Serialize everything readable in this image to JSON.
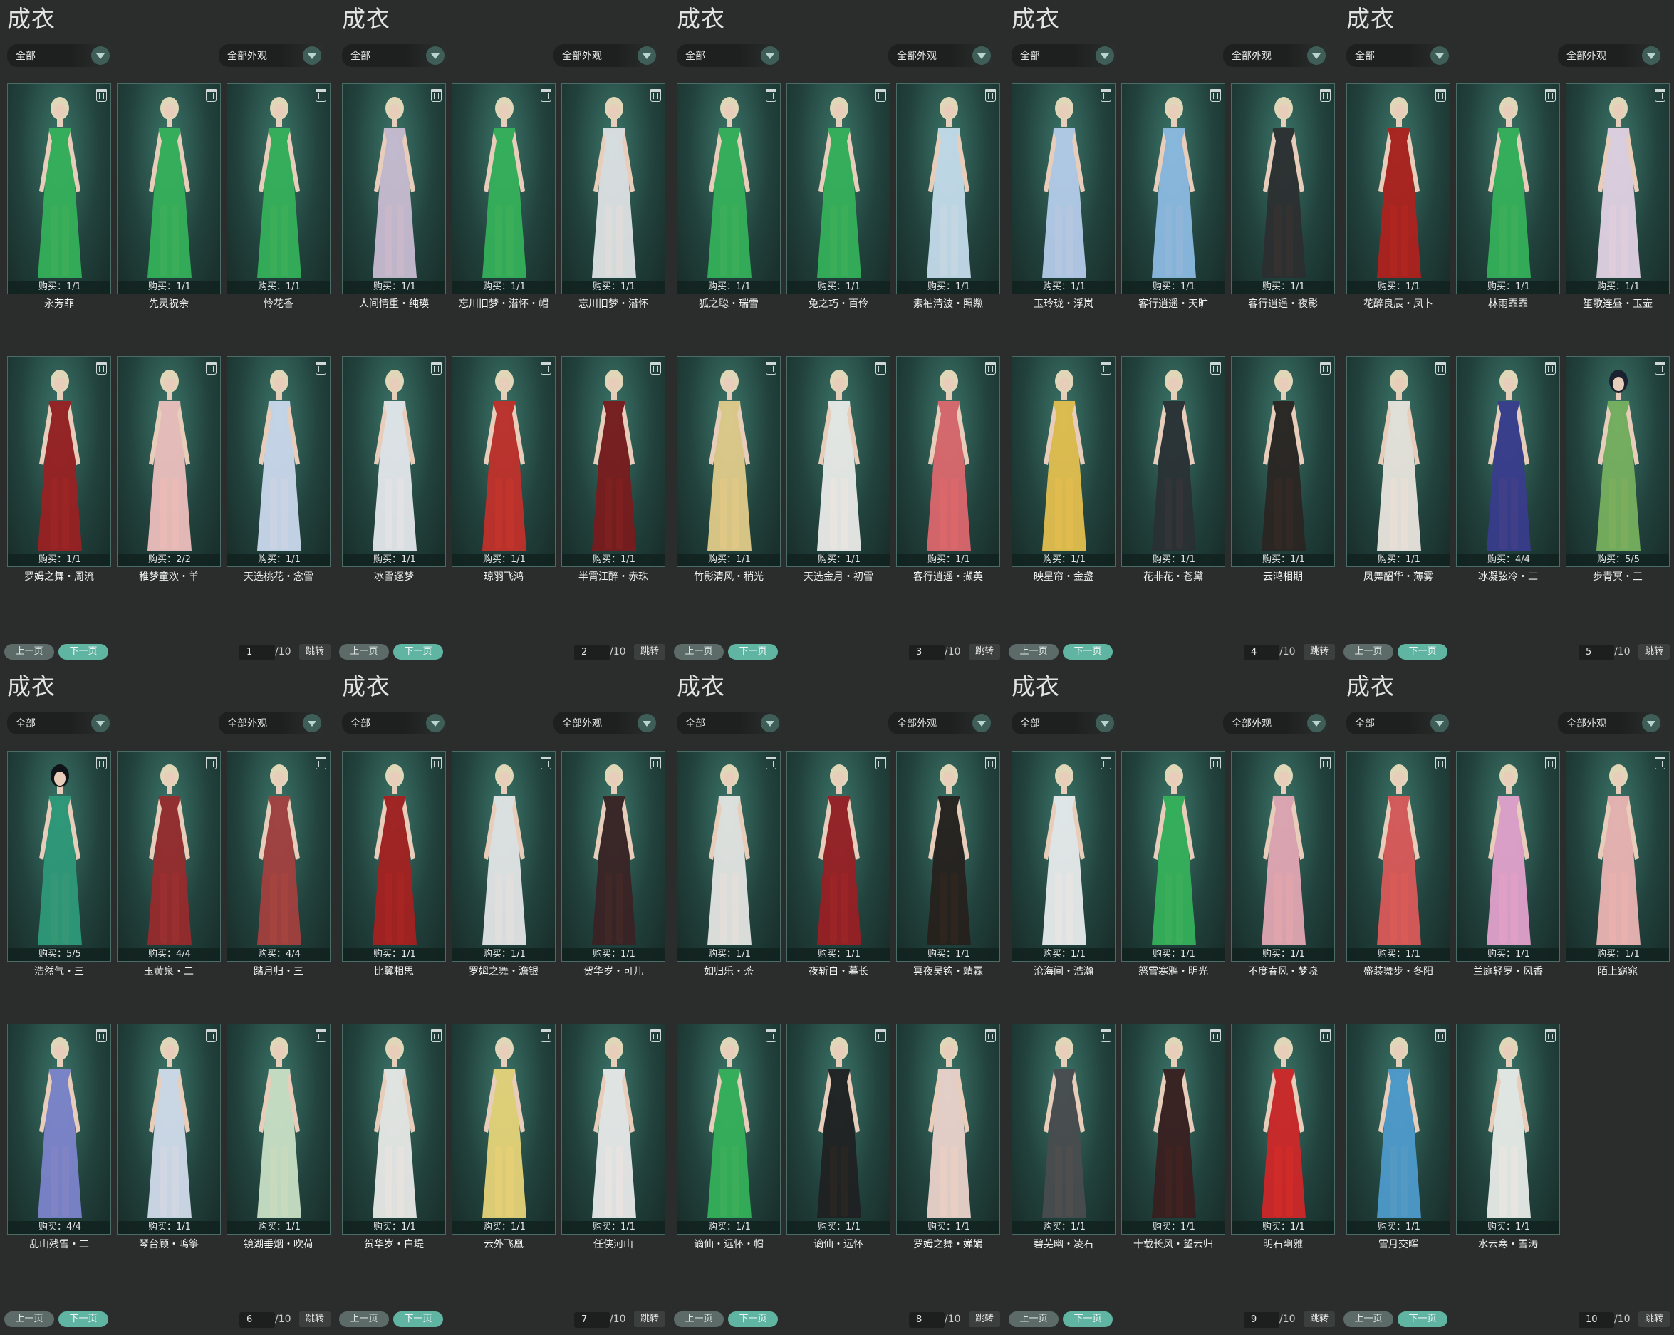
{
  "colors": {
    "background": "#2b2d2d",
    "card_bg": "#2c5a52",
    "next_button": "#5fb4a2",
    "prev_button": "#5d6b68"
  },
  "icons": {
    "delete": "trash-icon",
    "dropdown": "chevron-down-icon"
  },
  "panels": [
    {
      "title": "成衣",
      "category": "全部",
      "filter": "全部外观",
      "prev": "上一页",
      "next": "下一页",
      "page": "1",
      "total": "/10",
      "jump": "跳转",
      "items": [
        {
          "name": "永芳菲",
          "buy": "购买：1/1",
          "outfit": "#35b35a",
          "hair": "#dfd7b8"
        },
        {
          "name": "先灵祝余",
          "buy": "购买：1/1",
          "outfit": "#35b35a",
          "hair": "#dfd7b8"
        },
        {
          "name": "怜花香",
          "buy": "购买：1/1",
          "outfit": "#35b35a",
          "hair": "#dfd7b8"
        },
        {
          "name": "罗姆之舞・周流",
          "buy": "购买：1/1",
          "outfit": "#9c1f22",
          "hair": "#dfd7b8"
        },
        {
          "name": "稚梦童欢・羊",
          "buy": "购买：2/2",
          "outfit": "#f2c2c0",
          "hair": "#dfd7b8"
        },
        {
          "name": "天选桃花・念雪",
          "buy": "购买：1/1",
          "outfit": "#cfdcf1",
          "hair": "#dfd7b8"
        }
      ]
    },
    {
      "title": "成衣",
      "category": "全部",
      "filter": "全部外观",
      "prev": "上一页",
      "next": "下一页",
      "page": "2",
      "total": "/10",
      "jump": "跳转",
      "items": [
        {
          "name": "人间情重・纯瑛",
          "buy": "购买：1/1",
          "outfit": "#cdbfd6",
          "hair": "#dfd7b8"
        },
        {
          "name": "忘川旧梦・潜怀・帽",
          "buy": "购买：1/1",
          "outfit": "#35b35a",
          "hair": "#dfd7b8"
        },
        {
          "name": "忘川旧梦・潜怀",
          "buy": "购买：1/1",
          "outfit": "#e4e6e8",
          "hair": "#dfd7b8"
        },
        {
          "name": "冰雪逐梦",
          "buy": "购买：1/1",
          "outfit": "#e9ecf1",
          "hair": "#dfd7b8"
        },
        {
          "name": "琼羽飞鸿",
          "buy": "购买：1/1",
          "outfit": "#c6302a",
          "hair": "#dfd7b8"
        },
        {
          "name": "半霄江醉・赤珠",
          "buy": "购买：1/1",
          "outfit": "#7c1a1c",
          "hair": "#dfd7b8"
        }
      ]
    },
    {
      "title": "成衣",
      "category": "全部",
      "filter": "全部外观",
      "prev": "上一页",
      "next": "下一页",
      "page": "3",
      "total": "/10",
      "jump": "跳转",
      "items": [
        {
          "name": "狐之聪・瑞雪",
          "buy": "购买：1/1",
          "outfit": "#35b35a",
          "hair": "#dfd7b8"
        },
        {
          "name": "兔之巧・百伶",
          "buy": "购买：1/1",
          "outfit": "#35b35a",
          "hair": "#dfd7b8"
        },
        {
          "name": "素袖清波・照粼",
          "buy": "购买：1/1",
          "outfit": "#c9e0f0",
          "hair": "#dfd7b8"
        },
        {
          "name": "竹影清风・稍光",
          "buy": "购买：1/1",
          "outfit": "#e6cf8c",
          "hair": "#dfd7b8"
        },
        {
          "name": "天选金月・初雪",
          "buy": "购买：1/1",
          "outfit": "#f0f0ee",
          "hair": "#dfd7b8"
        },
        {
          "name": "客行逍遥・撷英",
          "buy": "购买：1/1",
          "outfit": "#e1686f",
          "hair": "#dfd7b8"
        }
      ]
    },
    {
      "title": "成衣",
      "category": "全部",
      "filter": "全部外观",
      "prev": "上一页",
      "next": "下一页",
      "page": "4",
      "total": "/10",
      "jump": "跳转",
      "items": [
        {
          "name": "玉玲珑・浮岚",
          "buy": "购买：1/1",
          "outfit": "#b9cfee",
          "hair": "#dfd7b8"
        },
        {
          "name": "客行逍遥・天旷",
          "buy": "购买：1/1",
          "outfit": "#8fbde6",
          "hair": "#dfd7b8"
        },
        {
          "name": "客行逍遥・夜影",
          "buy": "购买：1/1",
          "outfit": "#2c2e30",
          "hair": "#dfd7b8"
        },
        {
          "name": "映星帘・金盏",
          "buy": "购买：1/1",
          "outfit": "#e8c24f",
          "hair": "#dfd7b8"
        },
        {
          "name": "花非花・苍黛",
          "buy": "购买：1/1",
          "outfit": "#2a3034",
          "hair": "#dfd7b8"
        },
        {
          "name": "云鸿相期",
          "buy": "购买：1/1",
          "outfit": "#2a2422",
          "hair": "#dfd7b8"
        }
      ]
    },
    {
      "title": "成衣",
      "category": "全部",
      "filter": "全部外观",
      "prev": "上一页",
      "next": "下一页",
      "page": "5",
      "total": "/10",
      "jump": "跳转",
      "items": [
        {
          "name": "花醉良辰・凤卜",
          "buy": "购买：1/1",
          "outfit": "#b2211d",
          "hair": "#dfd7b8"
        },
        {
          "name": "林雨霏霏",
          "buy": "购买：1/1",
          "outfit": "#35b35a",
          "hair": "#dfd7b8"
        },
        {
          "name": "笙歌连昼・玉壶",
          "buy": "购买：1/1",
          "outfit": "#e7d6e8",
          "hair": "#dfd7b8"
        },
        {
          "name": "凤舞韶华・薄雾",
          "buy": "购买：1/1",
          "outfit": "#efe9e2",
          "hair": "#dfd7b8"
        },
        {
          "name": "冰凝弦冷・二",
          "buy": "购买：4/4",
          "outfit": "#3a3c8e",
          "hair": "#dfd7b8"
        },
        {
          "name": "步青冥・三",
          "buy": "购买：5/5",
          "outfit": "#79b35f",
          "hair": "#1a2230"
        }
      ]
    },
    {
      "title": "成衣",
      "category": "全部",
      "filter": "全部外观",
      "prev": "上一页",
      "next": "下一页",
      "page": "6",
      "total": "/10",
      "jump": "跳转",
      "items": [
        {
          "name": "浩然气・三",
          "buy": "购买：5/5",
          "outfit": "#2f9b7b",
          "hair": "#101418"
        },
        {
          "name": "玉黄泉・二",
          "buy": "购买：4/4",
          "outfit": "#9a2a2c",
          "hair": "#dfd7b8"
        },
        {
          "name": "踏月归・三",
          "buy": "购买：4/4",
          "outfit": "#a7403f",
          "hair": "#dfd7b8"
        },
        {
          "name": "乱山残雪・二",
          "buy": "购买：4/4",
          "outfit": "#7f86cf",
          "hair": "#dfd7b8"
        },
        {
          "name": "琴台顾・鸣筝",
          "buy": "购买：1/1",
          "outfit": "#d6dff0",
          "hair": "#dfd7b8"
        },
        {
          "name": "镜湖垂烟・吹荷",
          "buy": "购买：1/1",
          "outfit": "#cde4c9",
          "hair": "#dfd7b8"
        }
      ]
    },
    {
      "title": "成衣",
      "category": "全部",
      "filter": "全部外观",
      "prev": "上一页",
      "next": "下一页",
      "page": "7",
      "total": "/10",
      "jump": "跳转",
      "items": [
        {
          "name": "比翼相思",
          "buy": "购买：1/1",
          "outfit": "#a81f1f",
          "hair": "#dfd7b8"
        },
        {
          "name": "罗姆之舞・澹银",
          "buy": "购买：1/1",
          "outfit": "#e8e9ea",
          "hair": "#dfd7b8"
        },
        {
          "name": "贺华岁・可儿",
          "buy": "购买：1/1",
          "outfit": "#3b2224",
          "hair": "#dfd7b8"
        },
        {
          "name": "贺华岁・白堤",
          "buy": "购买：1/1",
          "outfit": "#eeeeec",
          "hair": "#dfd7b8"
        },
        {
          "name": "云外飞凰",
          "buy": "购买：1/1",
          "outfit": "#ecd77b",
          "hair": "#dfd7b8"
        },
        {
          "name": "任侠河山",
          "buy": "购买：1/1",
          "outfit": "#eeeeee",
          "hair": "#dfd7b8"
        }
      ]
    },
    {
      "title": "成衣",
      "category": "全部",
      "filter": "全部外观",
      "prev": "上一页",
      "next": "下一页",
      "page": "8",
      "total": "/10",
      "jump": "跳转",
      "items": [
        {
          "name": "如归乐・荼",
          "buy": "购买：1/1",
          "outfit": "#e9e9e7",
          "hair": "#dfd7b8"
        },
        {
          "name": "夜斩白・暮长",
          "buy": "购买：1/1",
          "outfit": "#9b1e24",
          "hair": "#dfd7b8"
        },
        {
          "name": "冥夜吴钩・靖霖",
          "buy": "购买：1/1",
          "outfit": "#26201c",
          "hair": "#dfd7b8"
        },
        {
          "name": "谪仙・远怀・帽",
          "buy": "购买：1/1",
          "outfit": "#35b35a",
          "hair": "#dfd7b8"
        },
        {
          "name": "谪仙・远怀",
          "buy": "购买：1/1",
          "outfit": "#1f1f21",
          "hair": "#dfd7b8"
        },
        {
          "name": "罗姆之舞・婵娟",
          "buy": "购买：1/1",
          "outfit": "#f1d7cf",
          "hair": "#dfd7b8"
        }
      ]
    },
    {
      "title": "成衣",
      "category": "全部",
      "filter": "全部外观",
      "prev": "上一页",
      "next": "下一页",
      "page": "9",
      "total": "/10",
      "jump": "跳转",
      "items": [
        {
          "name": "沧海间・浩瀚",
          "buy": "购买：1/1",
          "outfit": "#eef0f1",
          "hair": "#dfd7b8"
        },
        {
          "name": "怒雪寒鸦・明光",
          "buy": "购买：1/1",
          "outfit": "#35b35a",
          "hair": "#dfd7b8"
        },
        {
          "name": "不度春风・梦晓",
          "buy": "购买：1/1",
          "outfit": "#e7a9b6",
          "hair": "#dfd7b8"
        },
        {
          "name": "碧芜幽・凌石",
          "buy": "购买：1/1",
          "outfit": "#4a4c4f",
          "hair": "#dfd7b8"
        },
        {
          "name": "十载长风・望云归",
          "buy": "购买：1/1",
          "outfit": "#3a1d1e",
          "hair": "#dfd7b8"
        },
        {
          "name": "明石幽雅",
          "buy": "购买：1/1",
          "outfit": "#d42627",
          "hair": "#dfd7b8"
        }
      ]
    },
    {
      "title": "成衣",
      "category": "全部",
      "filter": "全部外观",
      "prev": "上一页",
      "next": "下一页",
      "page": "10",
      "total": "/10",
      "jump": "跳转",
      "items": [
        {
          "name": "盛装舞步・冬阳",
          "buy": "购买：1/1",
          "outfit": "#e05a5a",
          "hair": "#dfd7b8"
        },
        {
          "name": "兰庭轻罗・风香",
          "buy": "购买：1/1",
          "outfit": "#e7a4cf",
          "hair": "#dfd7b8"
        },
        {
          "name": "陌上窈窕",
          "buy": "购买：1/1",
          "outfit": "#f1b7b6",
          "hair": "#dfd7b8"
        },
        {
          "name": "雪月交晖",
          "buy": "购买：1/1",
          "outfit": "#4f9ccf",
          "hair": "#dfd7b8"
        },
        {
          "name": "水云寒・雪涛",
          "buy": "购买：1/1",
          "outfit": "#eef0ed",
          "hair": "#dfd7b8"
        }
      ]
    }
  ]
}
